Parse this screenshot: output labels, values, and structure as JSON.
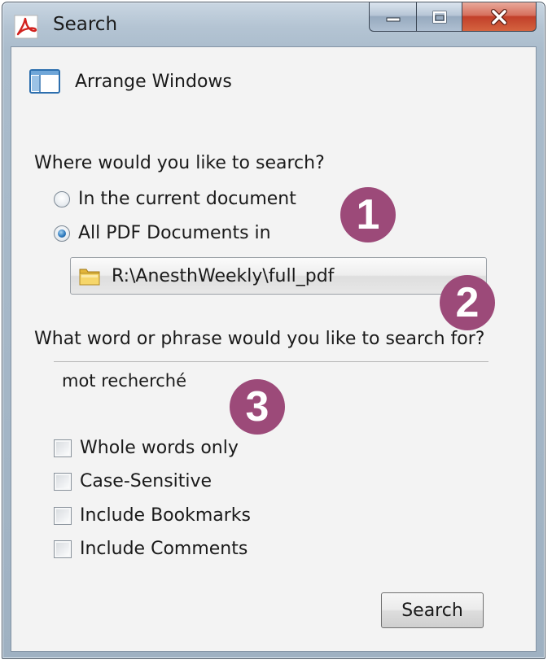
{
  "window": {
    "title": "Search",
    "title_icon": "acrobat-icon",
    "caption_buttons": [
      "minimize-icon",
      "maximize-icon",
      "close-icon"
    ]
  },
  "arrange": {
    "label": "Arrange Windows",
    "icon": "arrange-windows-icon"
  },
  "location": {
    "question": "Where would you like to search?",
    "options": [
      {
        "label": "In the current document",
        "checked": false
      },
      {
        "label": "All PDF Documents in",
        "checked": true
      }
    ],
    "folder_icon": "folder-icon",
    "path": "R:\\AnesthWeekly\\full_pdf"
  },
  "query": {
    "question": "What word or phrase would you like to search for?",
    "value": "mot recherché"
  },
  "options": [
    {
      "label": "Whole words only",
      "checked": false
    },
    {
      "label": "Case-Sensitive",
      "checked": false
    },
    {
      "label": "Include Bookmarks",
      "checked": false
    },
    {
      "label": "Include Comments",
      "checked": false
    }
  ],
  "search_button": {
    "label": "Search"
  },
  "callouts": [
    "1",
    "2",
    "3"
  ],
  "colors": {
    "callout": "#9c4a79",
    "close_button": "#c2402a",
    "radio_selected": "#2f7bbf"
  }
}
